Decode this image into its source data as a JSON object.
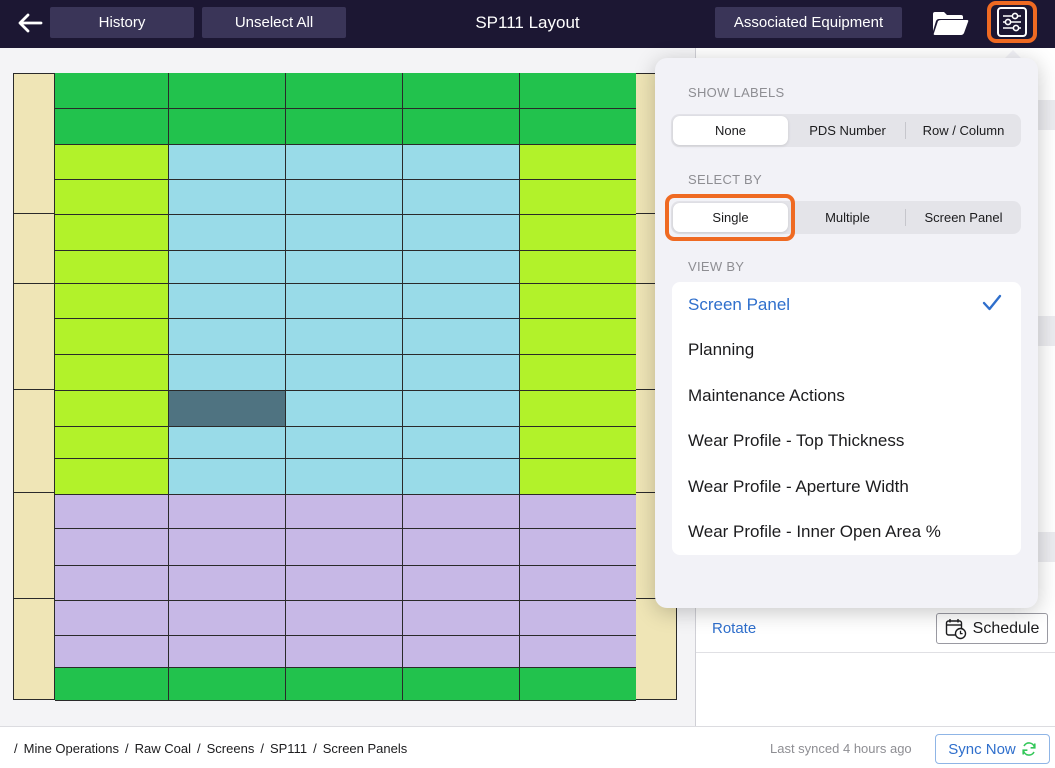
{
  "header": {
    "title": "SP111 Layout",
    "history_label": "History",
    "unselect_all_label": "Unselect All",
    "associated_equipment_label": "Associated Equipment",
    "icons": [
      "arrow-left-icon",
      "folder-icon",
      "settings-sliders-icon"
    ]
  },
  "layout_grid": {
    "colors": {
      "green": "#22c24d",
      "lime": "#b2f22a",
      "blue": "#99dbe8",
      "purple": "#c7b8e6",
      "selected": "#4f7381",
      "frame": "#efe5b6"
    },
    "rows": [
      [
        "green",
        "green",
        "green",
        "green",
        "green"
      ],
      [
        "green",
        "green",
        "green",
        "green",
        "green"
      ],
      [
        "lime",
        "blue",
        "blue",
        "blue",
        "lime"
      ],
      [
        "lime",
        "blue",
        "blue",
        "blue",
        "lime"
      ],
      [
        "lime",
        "blue",
        "blue",
        "blue",
        "lime"
      ],
      [
        "lime",
        "blue",
        "blue",
        "blue",
        "lime"
      ],
      [
        "lime",
        "blue",
        "blue",
        "blue",
        "lime"
      ],
      [
        "lime",
        "blue",
        "blue",
        "blue",
        "lime"
      ],
      [
        "lime",
        "blue",
        "blue",
        "blue",
        "lime"
      ],
      [
        "lime",
        "selected",
        "blue",
        "blue",
        "lime"
      ],
      [
        "lime",
        "blue",
        "blue",
        "blue",
        "lime"
      ],
      [
        "lime",
        "blue",
        "blue",
        "blue",
        "lime"
      ],
      [
        "purple",
        "purple",
        "purple",
        "purple",
        "purple"
      ],
      [
        "purple",
        "purple",
        "purple",
        "purple",
        "purple"
      ],
      [
        "purple",
        "purple",
        "purple",
        "purple",
        "purple"
      ],
      [
        "purple",
        "purple",
        "purple",
        "purple",
        "purple"
      ],
      [
        "purple",
        "purple",
        "purple",
        "purple",
        "purple"
      ],
      [
        "green",
        "green",
        "green",
        "green",
        "green"
      ]
    ]
  },
  "popover": {
    "show_labels": {
      "title": "SHOW LABELS",
      "options": [
        "None",
        "PDS Number",
        "Row / Column"
      ],
      "selected": "None"
    },
    "select_by": {
      "title": "SELECT BY",
      "options": [
        "Single",
        "Multiple",
        "Screen Panel"
      ],
      "selected": "Single"
    },
    "view_by": {
      "title": "VIEW BY",
      "options": [
        "Screen Panel",
        "Planning",
        "Maintenance Actions",
        "Wear Profile - Top Thickness",
        "Wear Profile - Aperture Width",
        "Wear Profile - Inner Open Area %"
      ],
      "selected": "Screen Panel"
    },
    "highlight_color": "#ef6a22"
  },
  "right_panel": {
    "rotate_label": "Rotate",
    "schedule_label": "Schedule"
  },
  "footer": {
    "breadcrumb": [
      "/",
      "Mine Operations",
      "/",
      "Raw Coal",
      "/",
      "Screens",
      "/",
      "SP111",
      "/",
      "Screen Panels"
    ],
    "sync_status": "Last synced 4 hours ago",
    "sync_button_label": "Sync Now"
  },
  "accent_color": "#2f6fcc"
}
